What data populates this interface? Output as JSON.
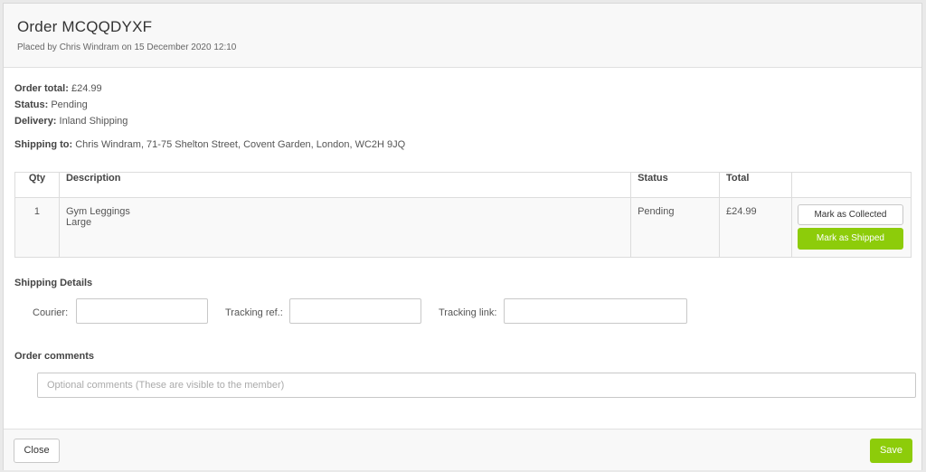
{
  "header": {
    "title": "Order MCQQDYXF",
    "subtitle": "Placed by Chris Windram on 15 December 2020 12:10"
  },
  "summary": {
    "order_total_label": "Order total:",
    "order_total_value": "£24.99",
    "status_label": "Status:",
    "status_value": "Pending",
    "delivery_label": "Delivery:",
    "delivery_value": "Inland Shipping",
    "shipping_to_label": "Shipping to:",
    "shipping_to_value": "Chris Windram, 71-75 Shelton Street, Covent Garden, London, WC2H 9JQ"
  },
  "items_table": {
    "columns": [
      "Qty",
      "Description",
      "Status",
      "Total",
      ""
    ],
    "rows": [
      {
        "qty": "1",
        "description": "Gym Leggings",
        "variant": "Large",
        "status": "Pending",
        "total": "£24.99",
        "collect_label": "Mark as Collected",
        "ship_label": "Mark as Shipped"
      }
    ]
  },
  "shipping_details": {
    "title": "Shipping Details",
    "courier_label": "Courier:",
    "courier_value": "",
    "tracking_ref_label": "Tracking ref.:",
    "tracking_ref_value": "",
    "tracking_link_label": "Tracking link:",
    "tracking_link_value": ""
  },
  "comments": {
    "title": "Order comments",
    "placeholder": "Optional comments (These are visible to the member)"
  },
  "footer": {
    "close_label": "Close",
    "save_label": "Save"
  },
  "colors": {
    "accent_green": "#8dcc0a",
    "header_bg": "#f8f8f8"
  }
}
